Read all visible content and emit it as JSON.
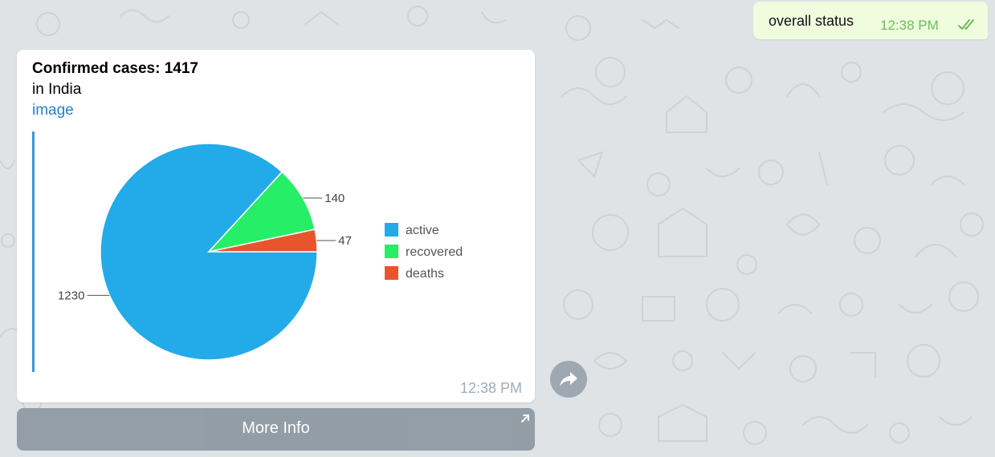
{
  "outgoing_message": {
    "text": "overall status",
    "time": "12:38 PM",
    "status_icon": "double-check-icon",
    "time_color": "#6dbc5d"
  },
  "incoming_message": {
    "title": "Confirmed cases: 1417",
    "subtitle": "in India",
    "link_text": "image",
    "time": "12:38 PM",
    "link_color": "#2481cc"
  },
  "forward_button": {
    "icon": "share-forward-icon"
  },
  "inline_button": {
    "label": "More Info",
    "icon": "external-arrow-icon"
  },
  "chart_data": {
    "type": "pie",
    "categories": [
      "active",
      "recovered",
      "deaths"
    ],
    "values": [
      1230,
      140,
      47
    ],
    "colors": [
      "#22abe8",
      "#26ee66",
      "#e8552d"
    ],
    "legend_position": "right",
    "data_labels": [
      "1230",
      "140",
      "47"
    ]
  }
}
